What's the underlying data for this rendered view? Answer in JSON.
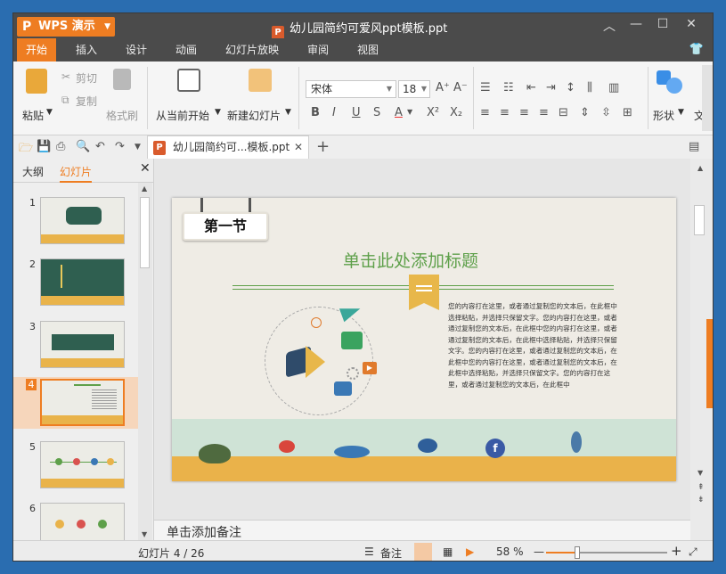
{
  "app": {
    "brand": "WPS 演示",
    "document_title": "幼儿园简约可爱风ppt模板.ppt"
  },
  "menu": {
    "tabs": [
      "开始",
      "插入",
      "设计",
      "动画",
      "幻灯片放映",
      "审阅",
      "视图"
    ],
    "active": "开始"
  },
  "ribbon": {
    "paste": "粘贴",
    "cut": "剪切",
    "copy": "复制",
    "format_painter": "格式刷",
    "play_from_current": "从当前开始",
    "new_slide": "新建幻灯片",
    "font_name": "宋体",
    "font_size": "18",
    "shape": "形状",
    "more": "文"
  },
  "doc_tab": {
    "label": "幼儿园简约可...模板.ppt"
  },
  "left_panel": {
    "tabs": [
      "大纲",
      "幻灯片"
    ],
    "active": "幻灯片",
    "slides": [
      {
        "num": "1"
      },
      {
        "num": "2"
      },
      {
        "num": "3"
      },
      {
        "num": "4"
      },
      {
        "num": "5"
      },
      {
        "num": "6"
      }
    ],
    "selected": "4"
  },
  "slide": {
    "section": "第一节",
    "title": "单击此处添加标题",
    "body": "您的内容打在这里，或者通过复制您的文本后，在此框中选择粘贴，并选择只保留文字。您的内容打在这里，或者通过复制您的文本后，在此框中您的内容打在这里，或者通过复制您的文本后，在此框中选择粘贴，并选择只保留文字。您的内容打在这里，或者通过复制您的文本后，在此框中您的内容打在这里，或者通过复制您的文本后，在此框中选择粘贴，并选择只保留文字。您的内容打在这里，或者通过复制您的文本后，在此框中"
  },
  "notes": {
    "placeholder": "单击添加备注"
  },
  "status": {
    "slide_counter": "幻灯片 4 / 26",
    "notes_label": "备注",
    "zoom": "58 %"
  },
  "colors": {
    "accent": "#ee7d22",
    "titlebar": "#4b4b4b",
    "slide_green": "#5ea04a"
  }
}
